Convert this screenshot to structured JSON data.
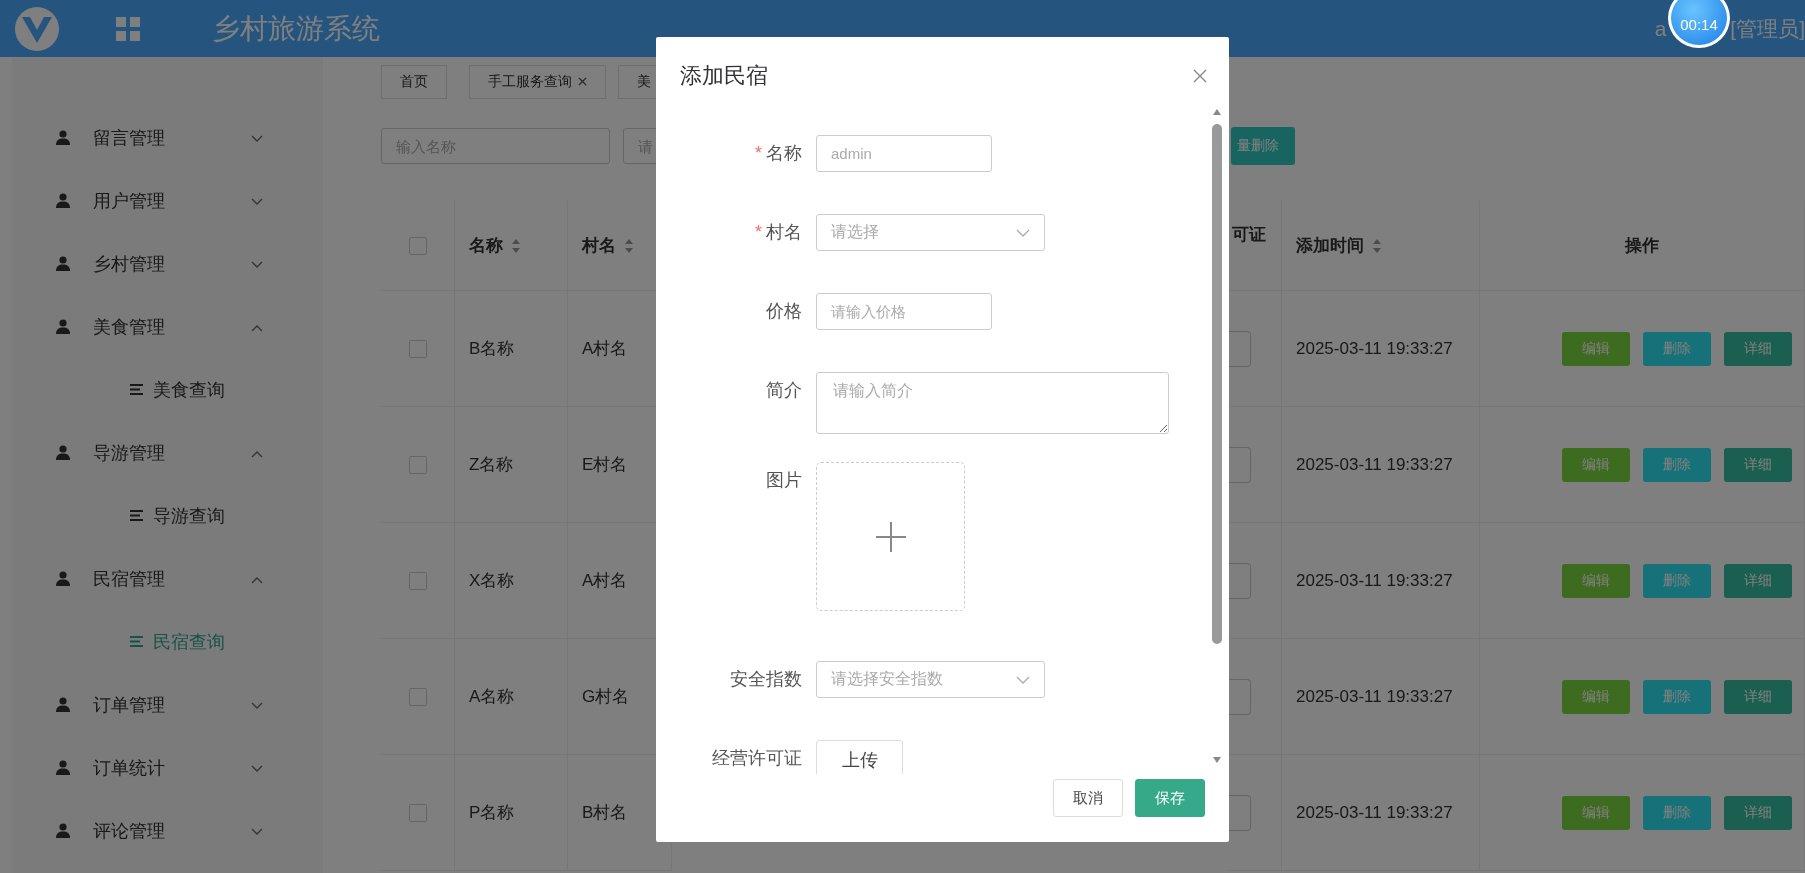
{
  "header": {
    "title": "乡村旅游系统",
    "user_start": "a",
    "role": "[管理员]"
  },
  "timer": "00:14",
  "sidebar": {
    "items": [
      {
        "label": "留言管理",
        "expanded": false
      },
      {
        "label": "用户管理",
        "expanded": false
      },
      {
        "label": "乡村管理",
        "expanded": false
      },
      {
        "label": "美食管理",
        "expanded": true,
        "children": [
          {
            "label": "美食查询",
            "selected": false
          }
        ]
      },
      {
        "label": "导游管理",
        "expanded": true,
        "children": [
          {
            "label": "导游查询",
            "selected": false
          }
        ]
      },
      {
        "label": "民宿管理",
        "expanded": true,
        "children": [
          {
            "label": "民宿查询",
            "selected": true
          }
        ]
      },
      {
        "label": "订单管理",
        "expanded": false
      },
      {
        "label": "订单统计",
        "expanded": false
      },
      {
        "label": "评论管理",
        "expanded": false
      }
    ]
  },
  "tabs": [
    {
      "label": "首页",
      "closable": false
    },
    {
      "label": "手工服务查询",
      "closable": true
    },
    {
      "label": "美",
      "closable": false
    }
  ],
  "filters": {
    "name_placeholder": "输入名称",
    "second_placeholder": "请",
    "batch_button": "量删除"
  },
  "table": {
    "header_checked": false,
    "columns": [
      {
        "label": "名称",
        "sortable": true
      },
      {
        "label": "村名",
        "sortable": true
      },
      {
        "label": "可证",
        "sortable": false
      },
      {
        "label": "添加时间",
        "sortable": true
      },
      {
        "label": "操作",
        "sortable": false
      }
    ],
    "rows": [
      {
        "checked": false,
        "name": "B名称",
        "village": "A村名",
        "time": "2025-03-11 19:33:27",
        "actions": [
          "编辑",
          "删除",
          "详细"
        ]
      },
      {
        "checked": false,
        "name": "Z名称",
        "village": "E村名",
        "time": "2025-03-11 19:33:27",
        "actions": [
          "编辑",
          "删除",
          "详细"
        ]
      },
      {
        "checked": false,
        "name": "X名称",
        "village": "A村名",
        "time": "2025-03-11 19:33:27",
        "actions": [
          "编辑",
          "删除",
          "详细"
        ]
      },
      {
        "checked": false,
        "name": "A名称",
        "village": "G村名",
        "time": "2025-03-11 19:33:27",
        "actions": [
          "编辑",
          "删除",
          "详细"
        ]
      },
      {
        "checked": false,
        "name": "P名称",
        "village": "B村名",
        "time": "2025-03-11 19:33:27",
        "actions": [
          "编辑",
          "删除",
          "详细"
        ]
      }
    ]
  },
  "dialog": {
    "title": "添加民宿",
    "fields": [
      {
        "kind": "input",
        "label": "名称",
        "required_mark": "*",
        "placeholder": "admin"
      },
      {
        "kind": "select",
        "label": "村名",
        "required_mark": "*",
        "placeholder": "请选择"
      },
      {
        "kind": "input",
        "label": "价格",
        "placeholder": "请输入价格"
      },
      {
        "kind": "textarea",
        "label": "简介",
        "placeholder": "请输入简介"
      },
      {
        "kind": "upload",
        "label": "图片"
      },
      {
        "kind": "select",
        "label": "安全指数",
        "placeholder": "请选择安全指数"
      },
      {
        "kind": "button",
        "label": "经营许可证",
        "button": "上传"
      }
    ],
    "buttons": [
      {
        "label": "取消",
        "primary": false
      },
      {
        "label": "保存",
        "primary": true
      }
    ]
  }
}
